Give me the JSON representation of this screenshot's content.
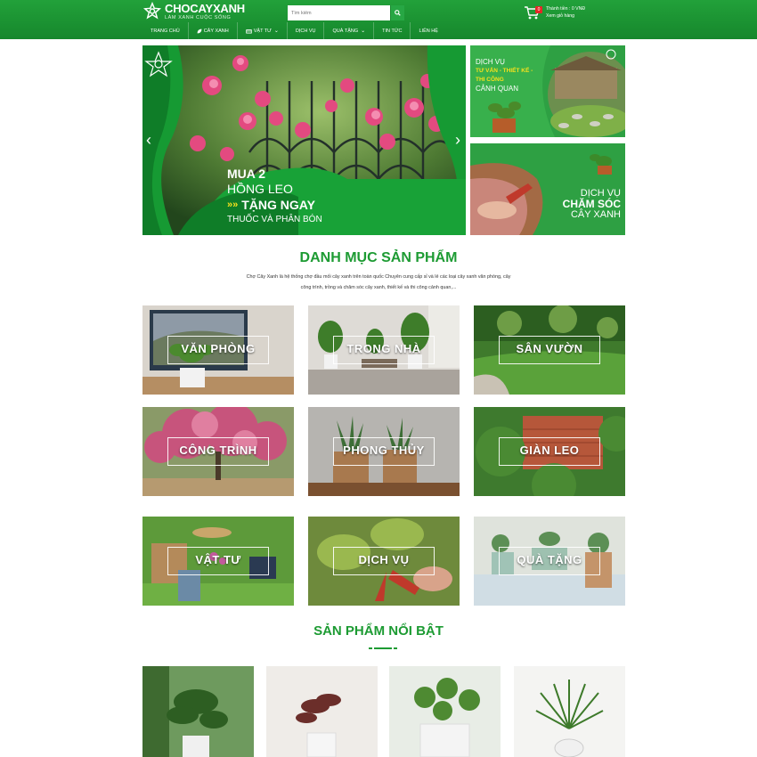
{
  "header": {
    "logo_name": "CHOCAYXANH",
    "logo_slogan": "LÀM XANH CUỘC SỐNG",
    "search_placeholder": "Tìm kiếm",
    "cart_count": "0",
    "cart_total": "Thành tiền : 0 VNĐ",
    "cart_link": "Xem giỏ hàng"
  },
  "nav": {
    "items": [
      {
        "label": "Trang chủ"
      },
      {
        "label": "Cây xanh",
        "icon": "leaf-icon"
      },
      {
        "label": "Vật tư",
        "icon": "box-icon",
        "dropdown": true
      },
      {
        "label": "Dịch vụ"
      },
      {
        "label": "Quà tặng",
        "dropdown": true
      },
      {
        "label": "Tin tức"
      },
      {
        "label": "Liên hệ"
      }
    ]
  },
  "slider": {
    "line1": "MUA 2",
    "line2": "HỒNG LEO",
    "line3": "TẶNG NGAY",
    "line4": "THUỐC VÀ PHÂN BÓN",
    "prev": "‹",
    "next": "›"
  },
  "side_banner_1": {
    "line1": "DỊCH VỤ",
    "line2": "TƯ VẤN - THIẾT KẾ -",
    "line3": "THI CÔNG",
    "line4": "CẢNH QUAN"
  },
  "side_banner_2": {
    "line1": "DỊCH VỤ",
    "line2": "CHĂM SÓC",
    "line3": "CÂY XANH"
  },
  "categories_section": {
    "title": "DANH MỤC SẢN PHẨM",
    "intro_1": "Chợ Cây Xanh là hệ thống chợ đầu mối cây xanh trên toàn quốc Chuyên cung cấp sỉ và lẻ các loại cây xanh văn phòng, cây",
    "intro_2": "công trình, trồng và chăm sóc cây xanh, thiết kế và thi công cảnh quan,..."
  },
  "categories": [
    {
      "label": "VĂN PHÒNG"
    },
    {
      "label": "TRONG NHÀ"
    },
    {
      "label": "SÂN VƯỜN"
    },
    {
      "label": "CÔNG TRÌNH"
    },
    {
      "label": "PHONG THỦY"
    },
    {
      "label": "GIÀN LEO"
    },
    {
      "label": "VẬT TƯ"
    },
    {
      "label": "DỊCH VỤ"
    },
    {
      "label": "QUÀ TẶNG"
    }
  ],
  "featured": {
    "title": "SẢN PHẨM NỔI BẬT"
  },
  "colors": {
    "brand_green": "#1d9b33",
    "header_green": "#16872c",
    "banner_yellow": "#f5e11d",
    "cart_badge": "#e62727"
  }
}
